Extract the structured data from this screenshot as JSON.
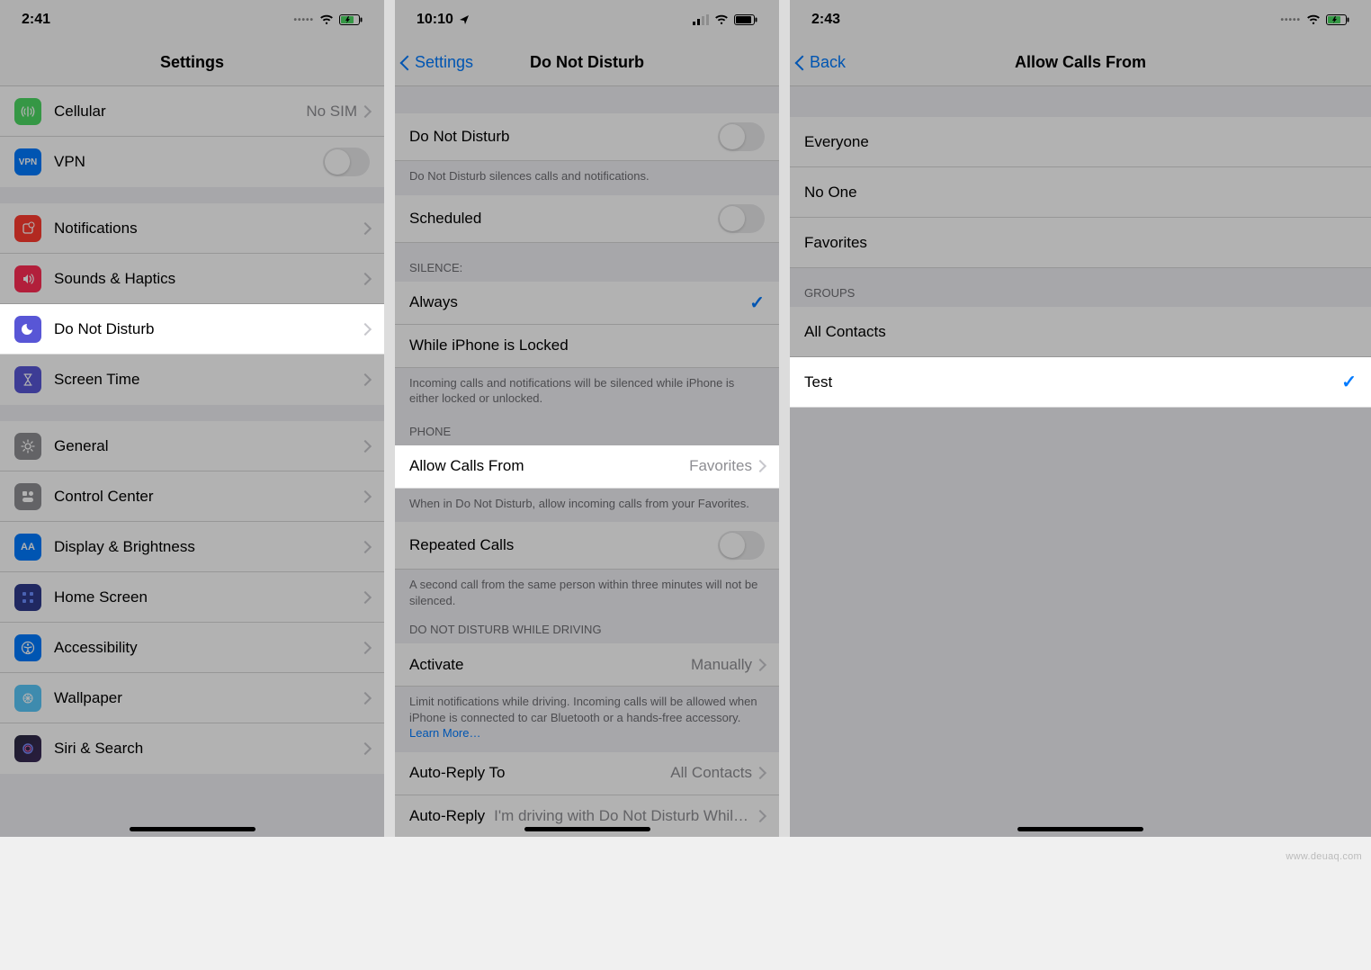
{
  "watermark": "www.deuaq.com",
  "screen1": {
    "time": "2:41",
    "title": "Settings",
    "items": {
      "cellular": {
        "label": "Cellular",
        "value": "No SIM"
      },
      "vpn": {
        "label": "VPN"
      },
      "notifications": {
        "label": "Notifications"
      },
      "sounds": {
        "label": "Sounds & Haptics"
      },
      "dnd": {
        "label": "Do Not Disturb"
      },
      "screentime": {
        "label": "Screen Time"
      },
      "general": {
        "label": "General"
      },
      "controlcenter": {
        "label": "Control Center"
      },
      "display": {
        "label": "Display & Brightness"
      },
      "homescreen": {
        "label": "Home Screen"
      },
      "accessibility": {
        "label": "Accessibility"
      },
      "wallpaper": {
        "label": "Wallpaper"
      },
      "siri": {
        "label": "Siri & Search"
      }
    }
  },
  "screen2": {
    "time": "10:10",
    "back": "Settings",
    "title": "Do Not Disturb",
    "rows": {
      "dnd": {
        "label": "Do Not Disturb"
      },
      "dnd_footer": "Do Not Disturb silences calls and notifications.",
      "scheduled": {
        "label": "Scheduled"
      },
      "silence_header": "SILENCE:",
      "always": {
        "label": "Always"
      },
      "while_locked": {
        "label": "While iPhone is Locked"
      },
      "silence_footer": "Incoming calls and notifications will be silenced while iPhone is either locked or unlocked.",
      "phone_header": "PHONE",
      "allow_calls": {
        "label": "Allow Calls From",
        "value": "Favorites"
      },
      "allow_calls_footer": "When in Do Not Disturb, allow incoming calls from your Favorites.",
      "repeated": {
        "label": "Repeated Calls"
      },
      "repeated_footer": "A second call from the same person within three minutes will not be silenced.",
      "driving_header": "DO NOT DISTURB WHILE DRIVING",
      "activate": {
        "label": "Activate",
        "value": "Manually"
      },
      "activate_footer": "Limit notifications while driving. Incoming calls will be allowed when iPhone is connected to car Bluetooth or a hands-free accessory. ",
      "learn_more": "Learn More…",
      "autoreply_to": {
        "label": "Auto-Reply To",
        "value": "All Contacts"
      },
      "autoreply": {
        "label": "Auto-Reply",
        "value": "I'm driving with Do Not Disturb While Dri…"
      }
    }
  },
  "screen3": {
    "time": "2:43",
    "back": "Back",
    "title": "Allow Calls From",
    "rows": {
      "everyone": "Everyone",
      "noone": "No One",
      "favorites": "Favorites",
      "groups_header": "GROUPS",
      "all_contacts": "All Contacts",
      "test": "Test"
    }
  }
}
